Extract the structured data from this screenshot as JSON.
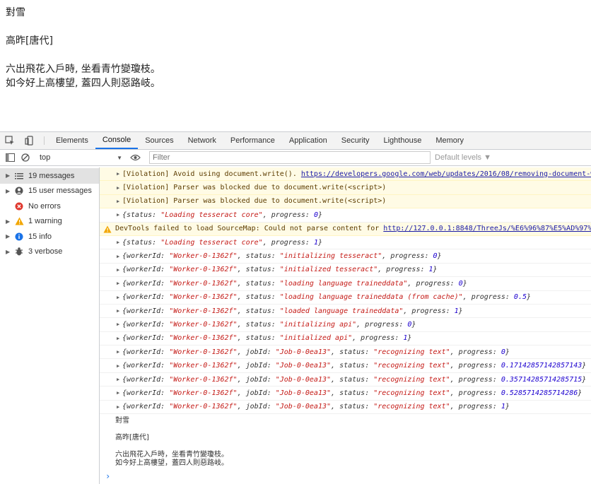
{
  "page": {
    "lines": [
      "對雪",
      "高昨[唐代]",
      "六出飛花入戶時, 坐看青竹變瓊枝。",
      "如今好上高樓望, 蓋四人則惡路岐。"
    ]
  },
  "devtools": {
    "tabs": [
      "Elements",
      "Console",
      "Sources",
      "Network",
      "Performance",
      "Application",
      "Security",
      "Lighthouse",
      "Memory"
    ],
    "active_tab": "Console",
    "context": "top",
    "filter_placeholder": "Filter",
    "levels": "Default levels ▼"
  },
  "sidebar": [
    {
      "label": "19 messages",
      "icon": "list-icon"
    },
    {
      "label": "15 user messages",
      "icon": "user-icon"
    },
    {
      "label": "No errors",
      "icon": "error-icon"
    },
    {
      "label": "1 warning",
      "icon": "warning-icon"
    },
    {
      "label": "15 info",
      "icon": "info-icon"
    },
    {
      "label": "3 verbose",
      "icon": "verbose-icon"
    }
  ],
  "console": {
    "violations": [
      {
        "text": "[Violation] Avoid using document.write(). ",
        "link": "https://developers.google.com/web/updates/2016/08/removing-document-wr"
      },
      {
        "text": "[Violation] Parser was blocked due to document.write(<script>)",
        "link": ""
      },
      {
        "text": "[Violation] Parser was blocked due to document.write(<script>)",
        "link": ""
      }
    ],
    "status0": {
      "status": "\"Loading tesseract core\"",
      "progress": "0"
    },
    "warning": {
      "text": "DevTools failed to load SourceMap: Could not parse content for ",
      "link": "http://127.0.0.1:8848/ThreeJs/%E6%96%87%E5%AD%97%E8"
    },
    "status1": {
      "status": "\"Loading tesseract core\"",
      "progress": "1"
    },
    "worker_rows": [
      {
        "workerId": "\"Worker-0-1362f\"",
        "jobId": "",
        "status": "\"initializing tesseract\"",
        "progress": "0"
      },
      {
        "workerId": "\"Worker-0-1362f\"",
        "jobId": "",
        "status": "\"initialized tesseract\"",
        "progress": "1"
      },
      {
        "workerId": "\"Worker-0-1362f\"",
        "jobId": "",
        "status": "\"loading language traineddata\"",
        "progress": "0"
      },
      {
        "workerId": "\"Worker-0-1362f\"",
        "jobId": "",
        "status": "\"loading language traineddata (from cache)\"",
        "progress": "0.5"
      },
      {
        "workerId": "\"Worker-0-1362f\"",
        "jobId": "",
        "status": "\"loaded language traineddata\"",
        "progress": "1"
      },
      {
        "workerId": "\"Worker-0-1362f\"",
        "jobId": "",
        "status": "\"initializing api\"",
        "progress": "0"
      },
      {
        "workerId": "\"Worker-0-1362f\"",
        "jobId": "",
        "status": "\"initialized api\"",
        "progress": "1"
      },
      {
        "workerId": "\"Worker-0-1362f\"",
        "jobId": "\"Job-0-0ea13\"",
        "status": "\"recognizing text\"",
        "progress": "0"
      },
      {
        "workerId": "\"Worker-0-1362f\"",
        "jobId": "\"Job-0-0ea13\"",
        "status": "\"recognizing text\"",
        "progress": "0.17142857142857143"
      },
      {
        "workerId": "\"Worker-0-1362f\"",
        "jobId": "\"Job-0-0ea13\"",
        "status": "\"recognizing text\"",
        "progress": "0.35714285714285715"
      },
      {
        "workerId": "\"Worker-0-1362f\"",
        "jobId": "\"Job-0-0ea13\"",
        "status": "\"recognizing text\"",
        "progress": "0.5285714285714286"
      },
      {
        "workerId": "\"Worker-0-1362f\"",
        "jobId": "\"Job-0-0ea13\"",
        "status": "\"recognizing text\"",
        "progress": "1"
      }
    ],
    "output_lines": [
      "對雪",
      "高昨[唐代]",
      "六出飛花入戶時，坐看青竹變瓊枝。",
      "如今好上高樓望，蓋四人則惡路岐。"
    ]
  },
  "colors": {
    "accent": "#1a73e8",
    "string": "#c41a16",
    "number": "#1c00cf",
    "warning_bg": "#fffbe5"
  }
}
